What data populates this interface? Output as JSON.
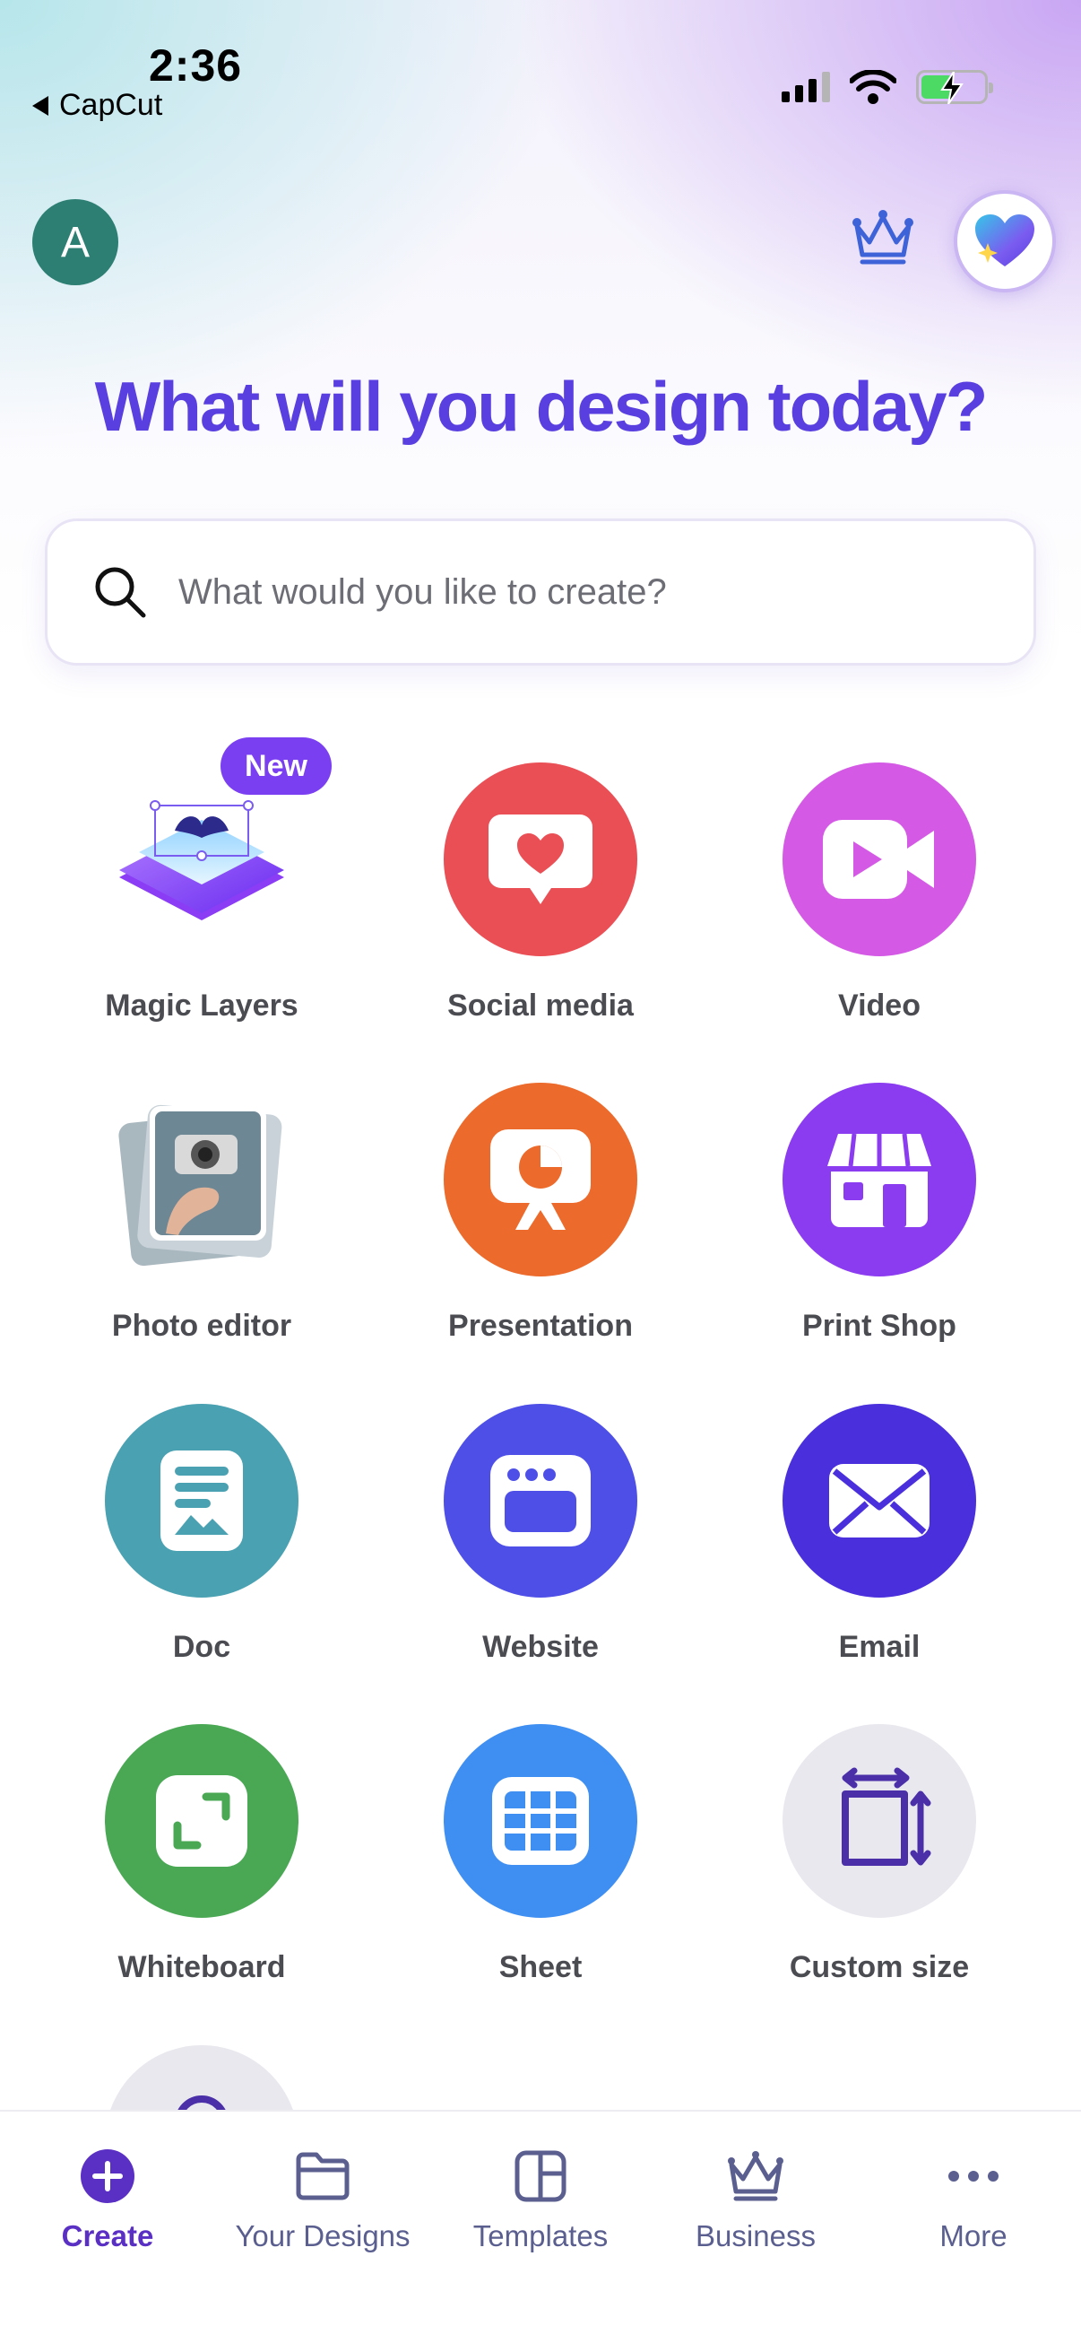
{
  "status_bar": {
    "time": "2:36",
    "back_app": "CapCut"
  },
  "header": {
    "avatar_initial": "A"
  },
  "title": "What will you design today?",
  "search": {
    "placeholder": "What would you like to create?"
  },
  "categories": [
    {
      "label": "Magic Layers",
      "badge": "New",
      "icon": "magic-layers-icon"
    },
    {
      "label": "Social media",
      "icon": "heart-speech-bubble-icon",
      "color": "#ea4f55"
    },
    {
      "label": "Video",
      "icon": "video-camera-icon",
      "color": "#d45ae6"
    },
    {
      "label": "Photo editor",
      "icon": "photo-editor-icon"
    },
    {
      "label": "Presentation",
      "icon": "presentation-easel-icon",
      "color": "#ec6a2b"
    },
    {
      "label": "Print Shop",
      "icon": "storefront-icon",
      "color": "#8b3cf0"
    },
    {
      "label": "Doc",
      "icon": "document-icon",
      "color": "#4aa1b1"
    },
    {
      "label": "Website",
      "icon": "browser-window-icon",
      "color": "#4e4fe6"
    },
    {
      "label": "Email",
      "icon": "envelope-icon",
      "color": "#4a2fdc"
    },
    {
      "label": "Whiteboard",
      "icon": "whiteboard-icon",
      "color": "#4aa855"
    },
    {
      "label": "Sheet",
      "icon": "table-grid-icon",
      "color": "#3f8ef2"
    },
    {
      "label": "Custom size",
      "icon": "resize-arrows-icon",
      "color": "#e8e8ee"
    }
  ],
  "bottom_nav": [
    {
      "label": "Create",
      "icon": "plus-circle-icon",
      "active": true
    },
    {
      "label": "Your Designs",
      "icon": "folder-icon"
    },
    {
      "label": "Templates",
      "icon": "templates-icon"
    },
    {
      "label": "Business",
      "icon": "crown-icon"
    },
    {
      "label": "More",
      "icon": "more-dots-icon"
    }
  ],
  "colors": {
    "accent": "#5a3fe0",
    "active_nav": "#5a2fc4",
    "nav_inactive": "#5b5f8f"
  }
}
